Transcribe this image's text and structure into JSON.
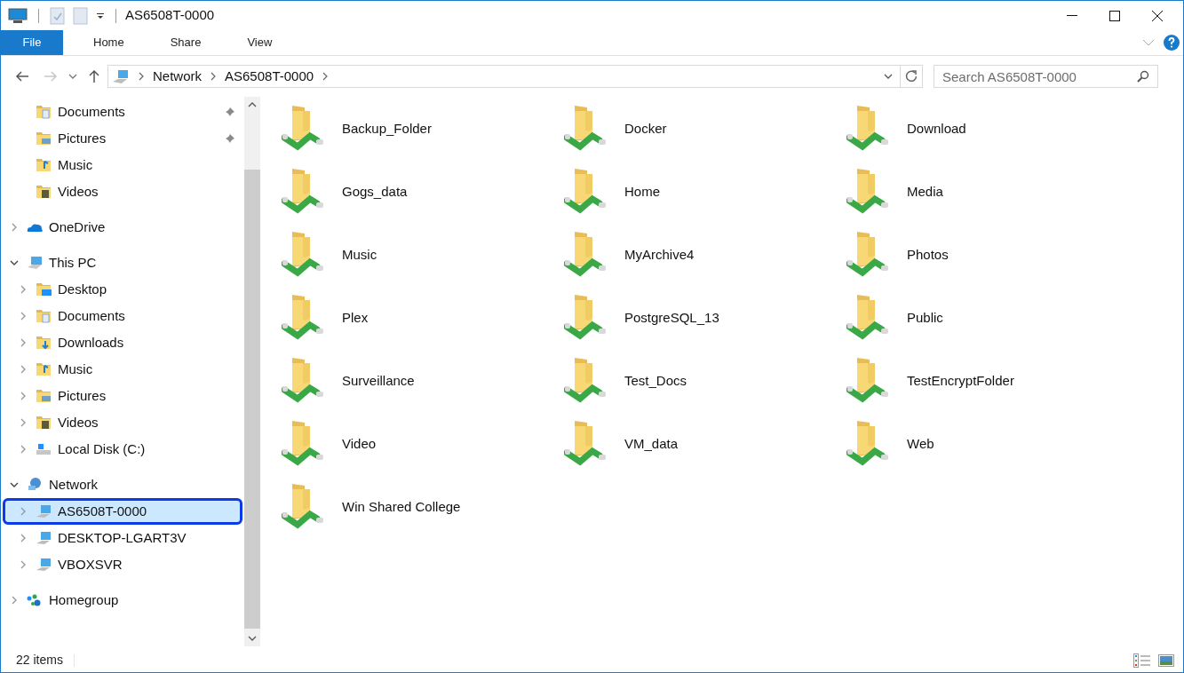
{
  "window": {
    "title": "AS6508T-0000"
  },
  "ribbon": {
    "tabs": [
      {
        "label": "File",
        "kind": "file"
      },
      {
        "label": "Home",
        "kind": "tab"
      },
      {
        "label": "Share",
        "kind": "tab"
      },
      {
        "label": "View",
        "kind": "tab"
      }
    ]
  },
  "navigation": {
    "back": {
      "disabled": false
    },
    "forward": {
      "disabled": true
    }
  },
  "address": {
    "crumbs": [
      "Network",
      "AS6508T-0000"
    ]
  },
  "search": {
    "placeholder": "Search AS6508T-0000"
  },
  "sidebar": {
    "pinned": [
      {
        "label": "Documents",
        "kind": "documents",
        "pinned": true,
        "selected": false
      },
      {
        "label": "Pictures",
        "kind": "pictures",
        "pinned": true,
        "selected": false
      },
      {
        "label": "Music",
        "kind": "music",
        "pinned": false,
        "selected": false
      },
      {
        "label": "Videos",
        "kind": "videos",
        "pinned": false,
        "selected": false
      }
    ],
    "tree": [
      {
        "label": "OneDrive",
        "kind": "cloud",
        "expanded": false,
        "selected": false
      },
      {
        "label": "This PC",
        "kind": "pc",
        "expanded": true,
        "selected": false,
        "children": [
          {
            "label": "Desktop",
            "kind": "desktop",
            "expanded": false,
            "selected": false
          },
          {
            "label": "Documents",
            "kind": "documents",
            "expanded": false,
            "selected": false
          },
          {
            "label": "Downloads",
            "kind": "downloads",
            "expanded": false,
            "selected": false
          },
          {
            "label": "Music",
            "kind": "music",
            "expanded": false,
            "selected": false
          },
          {
            "label": "Pictures",
            "kind": "pictures",
            "expanded": false,
            "selected": false
          },
          {
            "label": "Videos",
            "kind": "videos",
            "expanded": false,
            "selected": false
          },
          {
            "label": "Local Disk (C:)",
            "kind": "disk",
            "expanded": false,
            "selected": false
          }
        ]
      },
      {
        "label": "Network",
        "kind": "network",
        "expanded": true,
        "selected": false,
        "children": [
          {
            "label": "AS6508T-0000",
            "kind": "computer",
            "expanded": false,
            "selected": true
          },
          {
            "label": "DESKTOP-LGART3V",
            "kind": "computer",
            "expanded": false,
            "selected": false
          },
          {
            "label": "VBOXSVR",
            "kind": "computer",
            "expanded": false,
            "selected": false
          }
        ]
      },
      {
        "label": "Homegroup",
        "kind": "homegroup",
        "expanded": false,
        "selected": false
      }
    ]
  },
  "folders": [
    "Backup_Folder",
    "Docker",
    "Download",
    "Gogs_data",
    "Home",
    "Media",
    "Music",
    "MyArchive4",
    "Photos",
    "Plex",
    "PostgreSQL_13",
    "Public",
    "Surveillance",
    "Test_Docs",
    "TestEncryptFolder",
    "Video",
    "VM_data",
    "Web",
    "Win Shared College"
  ],
  "status_bar": {
    "count": "22 items"
  }
}
